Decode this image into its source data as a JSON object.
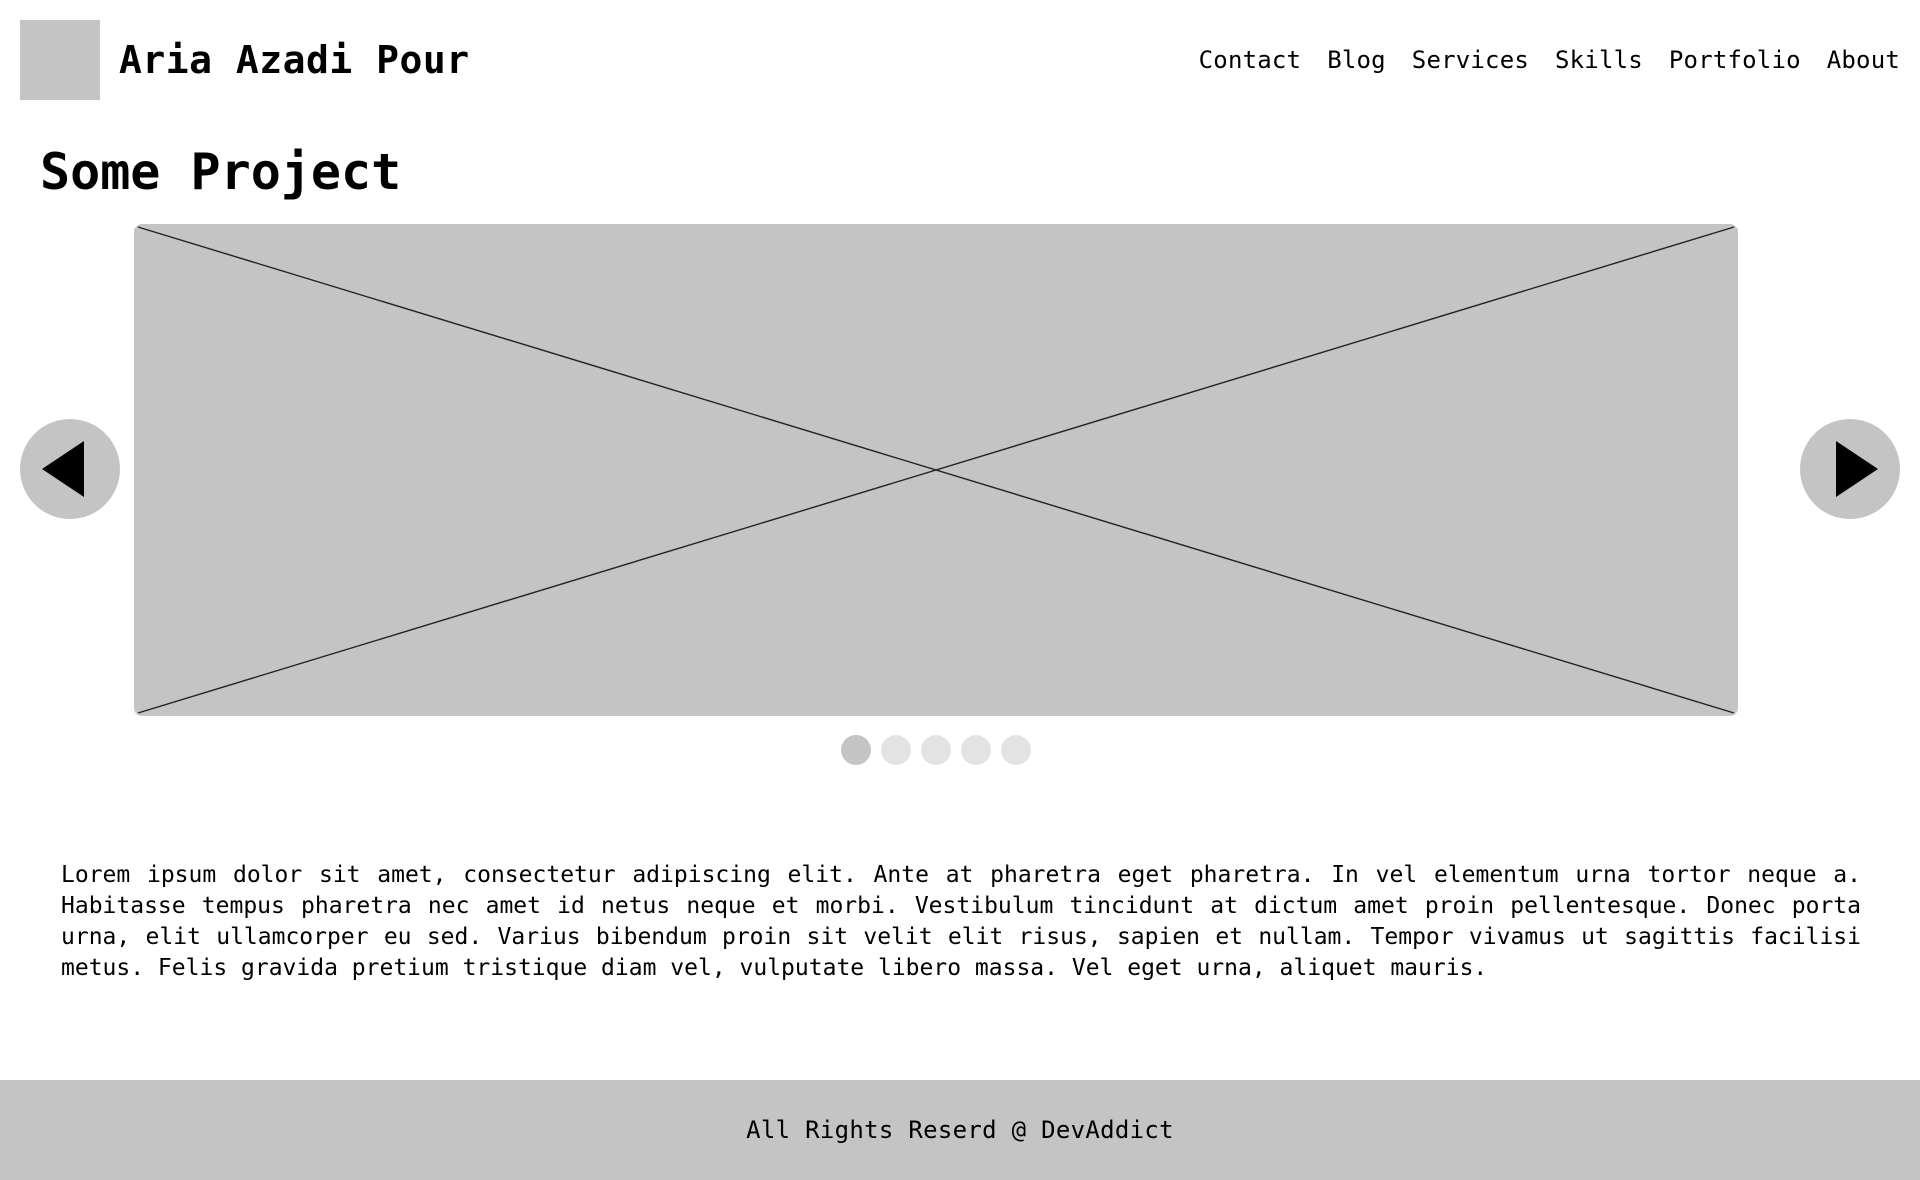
{
  "header": {
    "site_title": "Aria Azadi Pour",
    "nav": [
      "Contact",
      "Blog",
      "Services",
      "Skills",
      "Portfolio",
      "About"
    ]
  },
  "main": {
    "title": "Some Project",
    "carousel": {
      "slide_count": 5,
      "active_index": 0,
      "prev_icon": "triangle-left-icon",
      "next_icon": "triangle-right-icon",
      "placeholder_icon": "image-placeholder-icon"
    },
    "description": "Lorem ipsum dolor sit amet, consectetur adipiscing elit. Ante at pharetra eget pharetra. In vel elementum urna tortor neque a. Habitasse tempus pharetra nec amet id netus neque et morbi. Vestibulum tincidunt at dictum amet proin pellentesque. Donec porta urna, elit ullamcorper eu sed. Varius bibendum proin sit velit elit risus, sapien et nullam. Tempor vivamus ut sagittis facilisi metus. Felis gravida pretium tristique diam vel, vulputate libero massa. Vel eget urna, aliquet mauris."
  },
  "footer": {
    "text": "All Rights Reserd @ DevAddict"
  },
  "colors": {
    "placeholder": "#c4c4c4",
    "dot_inactive": "#e3e3e3",
    "text": "#000000",
    "background": "#ffffff"
  }
}
